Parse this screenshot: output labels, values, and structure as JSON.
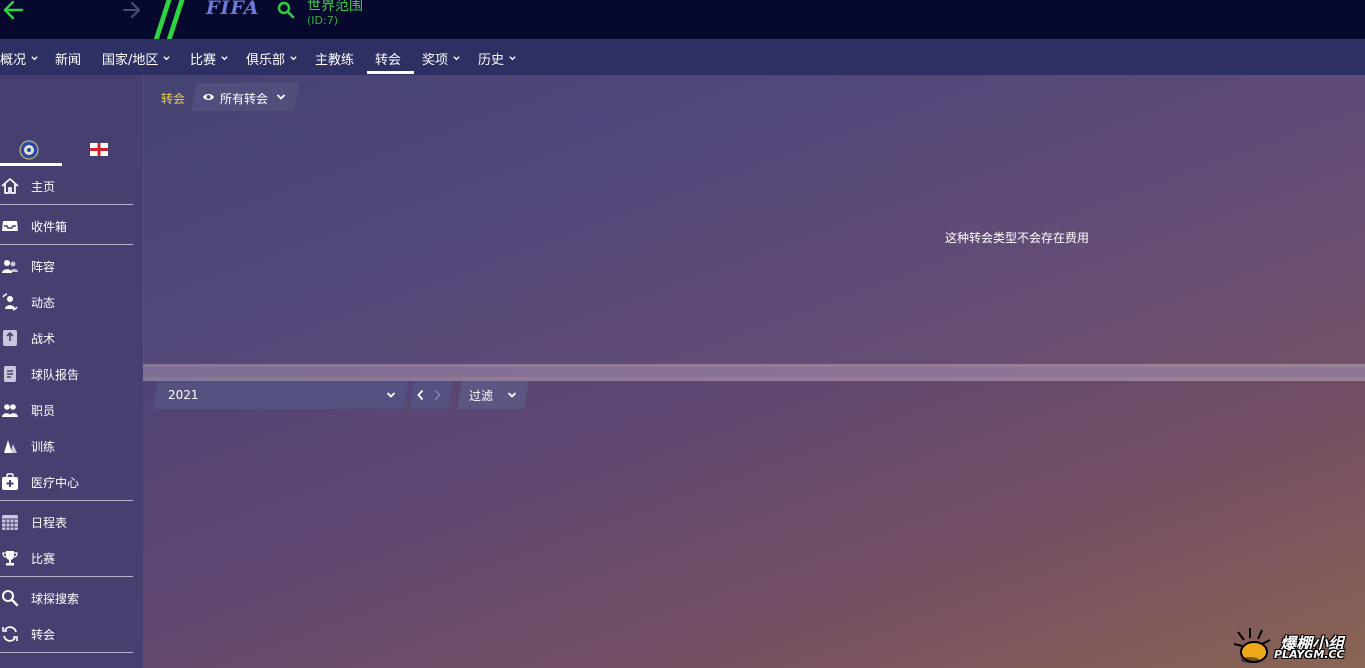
{
  "topbar": {
    "logo_text": "FIFA",
    "logo_mark": "®",
    "context_title": "世界范围",
    "context_id": "(ID:7)",
    "icons": [
      "back-arrow-icon",
      "forward-arrow-icon",
      "search-icon"
    ],
    "accent_color": "#2dd43f"
  },
  "nav": {
    "items": [
      {
        "label": "概况",
        "has_dropdown": true
      },
      {
        "label": "新闻",
        "has_dropdown": false
      },
      {
        "label": "国家/地区",
        "has_dropdown": true
      },
      {
        "label": "比赛",
        "has_dropdown": true
      },
      {
        "label": "俱乐部",
        "has_dropdown": true
      },
      {
        "label": "主教练",
        "has_dropdown": false
      },
      {
        "label": "转会",
        "has_dropdown": false,
        "active": true
      },
      {
        "label": "奖项",
        "has_dropdown": true
      },
      {
        "label": "历史",
        "has_dropdown": true
      }
    ]
  },
  "sidebar": {
    "tabs": [
      "club-crest-icon",
      "england-flag-icon"
    ],
    "items": [
      {
        "label": "主页",
        "icon": "home-icon"
      },
      {
        "label": "收件箱",
        "icon": "inbox-icon"
      },
      {
        "label": "阵容",
        "icon": "squad-icon"
      },
      {
        "label": "动态",
        "icon": "dynamics-icon"
      },
      {
        "label": "战术",
        "icon": "tactics-icon"
      },
      {
        "label": "球队报告",
        "icon": "report-icon"
      },
      {
        "label": "职员",
        "icon": "staff-icon"
      },
      {
        "label": "训练",
        "icon": "training-icon"
      },
      {
        "label": "医疗中心",
        "icon": "medical-icon"
      },
      {
        "label": "日程表",
        "icon": "calendar-icon"
      },
      {
        "label": "比赛",
        "icon": "trophy-icon"
      },
      {
        "label": "球探搜索",
        "icon": "search-icon"
      },
      {
        "label": "转会",
        "icon": "transfer-icon"
      }
    ]
  },
  "main": {
    "breadcrumb": "转会",
    "view_dropdown": "所有转会",
    "empty_message": "这种转会类型不会存在费用",
    "year_select": "2021",
    "filter_label": "过滤",
    "breadcrumb_color": "#e8d24a"
  },
  "watermark": {
    "title": "爆棚小组",
    "url": "PLAYGM.CC"
  }
}
